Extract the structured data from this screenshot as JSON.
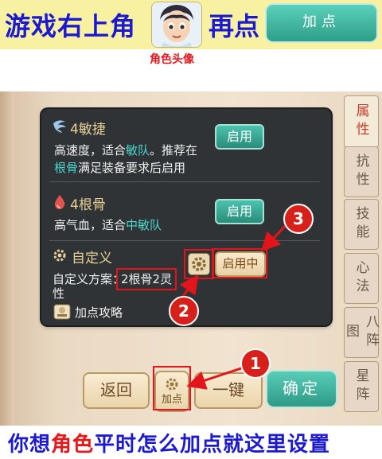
{
  "banner": {
    "text_before": "游戏右上角",
    "text_after": "再点",
    "button_label": "加点",
    "avatar_caption": "角色头像"
  },
  "panel": {
    "section1": {
      "title": "4敏捷",
      "desc_line1_a": "高速度，适合",
      "desc_line1_hl": "敏队",
      "desc_line1_b": "。推荐在",
      "desc_line2_hl": "根骨",
      "desc_line2_b": "满足装备要求后启用",
      "button": "启用"
    },
    "section2": {
      "title": "4根骨",
      "desc_a": "高气血，适合",
      "desc_hl": "中敏队",
      "button": "启用"
    },
    "section3": {
      "title": "自定义",
      "plan_label": "自定义方案：",
      "plan_value": "2根骨2灵",
      "plan_tail": "性",
      "status_button": "启用中",
      "guide": "加点攻略"
    }
  },
  "tabs": [
    {
      "label": "属性",
      "active": true
    },
    {
      "label": "抗性"
    },
    {
      "label": "技能"
    },
    {
      "label": "心法"
    },
    {
      "label": "八阵图"
    },
    {
      "label": "星阵"
    }
  ],
  "bottom_buttons": {
    "back": "返回",
    "addpoint": "加点",
    "one_key": "一键",
    "confirm": "确定"
  },
  "callouts": [
    "1",
    "2",
    "3"
  ],
  "bottom_text": {
    "a": "你想",
    "b": "角色",
    "c": "平时怎么加点就这里设置"
  },
  "colors": {
    "banner_bg": "#f7f1a1",
    "blue_text": "#1c1ad0",
    "red_accent": "#e3141a",
    "teal_button": "#2e9e89"
  }
}
